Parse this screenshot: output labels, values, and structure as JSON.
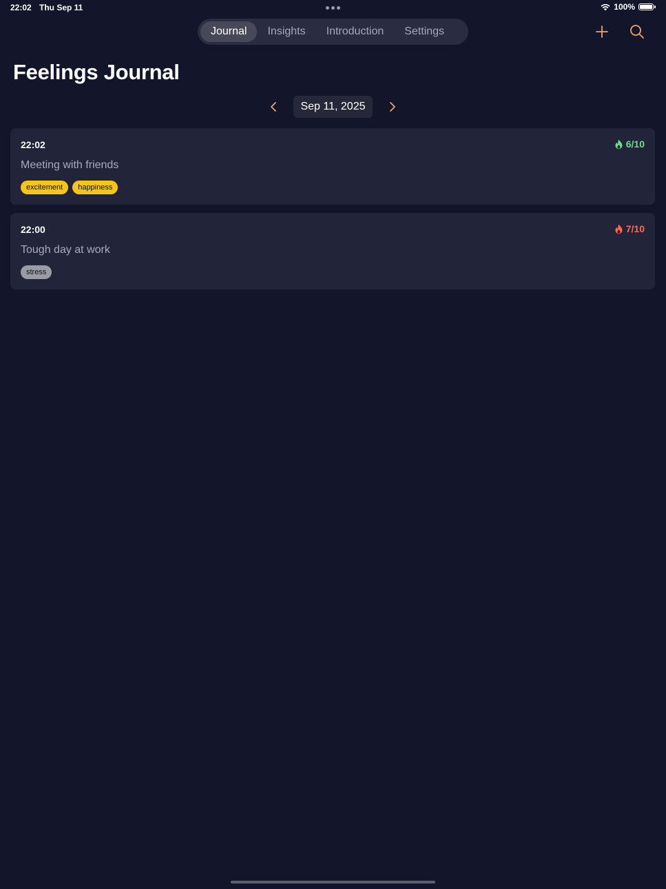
{
  "status_bar": {
    "time": "22:02",
    "date": "Thu Sep 11",
    "battery": "100%",
    "battery_level": 1.0
  },
  "tabs": [
    {
      "label": "Journal",
      "active": true
    },
    {
      "label": "Insights",
      "active": false
    },
    {
      "label": "Introduction",
      "active": false
    },
    {
      "label": "Settings",
      "active": false
    }
  ],
  "actions": {
    "add_icon": "plus-icon",
    "search_icon": "search-icon"
  },
  "page": {
    "title": "Feelings Journal"
  },
  "date_nav": {
    "date": "Sep 11, 2025",
    "prev_icon": "chevron-left-icon",
    "next_icon": "chevron-right-icon"
  },
  "colors": {
    "accent": "#f0a26a",
    "positive": "#6fdc8c",
    "negative": "#ff6b4a",
    "tag_yellow": "#f5c518",
    "tag_gray": "#9b9ba3",
    "background": "#13152a",
    "card": "#222439"
  },
  "entries": [
    {
      "time": "22:02",
      "intensity": "6/10",
      "intensity_color": "#6fdc8c",
      "icon": "flame-icon",
      "text": "Meeting with friends",
      "tags": [
        {
          "label": "excitement",
          "color": "#f5c518"
        },
        {
          "label": "happiness",
          "color": "#f5c518"
        }
      ]
    },
    {
      "time": "22:00",
      "intensity": "7/10",
      "intensity_color": "#ff6b4a",
      "icon": "flame-icon",
      "text": "Tough day at work",
      "tags": [
        {
          "label": "stress",
          "color": "#9b9ba3"
        }
      ]
    }
  ]
}
